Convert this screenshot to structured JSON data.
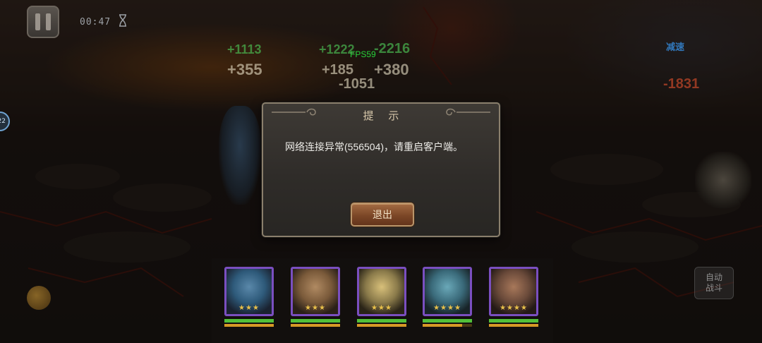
{
  "hud": {
    "timer": "00:47",
    "fps": "FPS59",
    "side_badge": "22",
    "status_tag": "减速",
    "auto_label": "自动战斗"
  },
  "floating_numbers": [
    {
      "text": "+1113",
      "kind": "heal"
    },
    {
      "text": "+355",
      "kind": "hit"
    },
    {
      "text": "+1222",
      "kind": "heal"
    },
    {
      "text": "-2216",
      "kind": "heal"
    },
    {
      "text": "+185",
      "kind": "hit"
    },
    {
      "text": "+380",
      "kind": "hit"
    },
    {
      "text": "-1051",
      "kind": "hit"
    },
    {
      "text": "-1831",
      "kind": "red"
    }
  ],
  "heroes": [
    {
      "stars": "★★★",
      "hp": 1.0,
      "mp": 1.0,
      "tint": "#2e5a7a"
    },
    {
      "stars": "★★★",
      "hp": 1.0,
      "mp": 1.0,
      "tint": "#7a5a3a"
    },
    {
      "stars": "★★★",
      "hp": 1.0,
      "mp": 1.0,
      "tint": "#8a7a4a"
    },
    {
      "stars": "★★★★",
      "hp": 1.0,
      "mp": 0.8,
      "tint": "#3a6a7a"
    },
    {
      "stars": "★★★★",
      "hp": 1.0,
      "mp": 1.0,
      "tint": "#6a4a3a"
    }
  ],
  "dialog": {
    "title": "提 示",
    "message": "网络连接异常(556504)，请重启客户端。",
    "exit_label": "退出"
  },
  "colors": {
    "accent": "#27d33a",
    "frame": "#8a7f6c",
    "button": "#7c4727",
    "portrait_border": "#7a4fc0"
  }
}
